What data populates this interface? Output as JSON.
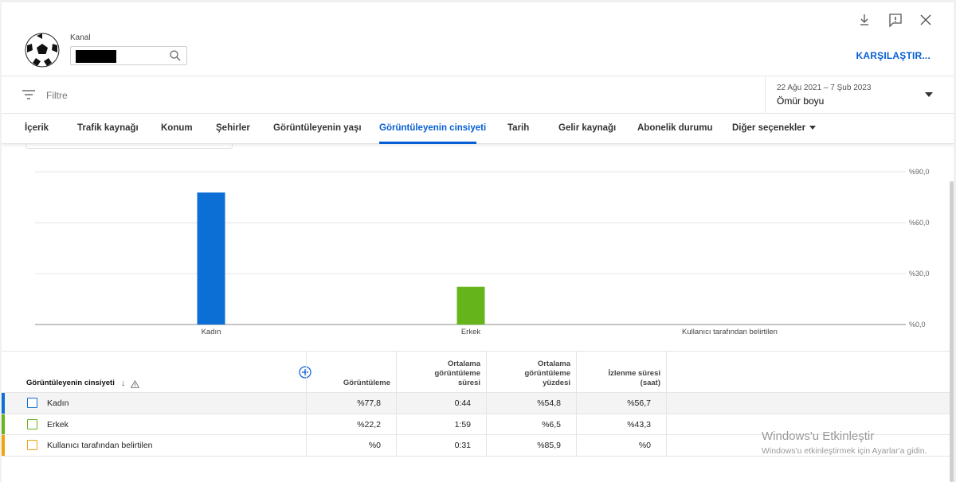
{
  "header": {
    "channel_label": "Kanal",
    "compare_label": "KARŞILAŞTIR..."
  },
  "filter": {
    "placeholder": "Filtre",
    "date_range": "22 Ağu 2021 – 7 Şub 2023",
    "date_preset": "Ömür boyu"
  },
  "tabs": [
    {
      "label": "İçerik"
    },
    {
      "label": "Trafik kaynağı"
    },
    {
      "label": "Konum"
    },
    {
      "label": "Şehirler"
    },
    {
      "label": "Görüntüleyenin yaşı"
    },
    {
      "label": "Görüntüleyenin cinsiyeti",
      "active": true
    },
    {
      "label": "Tarih"
    },
    {
      "label": "Gelir kaynağı"
    },
    {
      "label": "Abonelik durumu"
    },
    {
      "label": "Diğer seçenekler"
    }
  ],
  "chart_data": {
    "type": "bar",
    "categories": [
      "Kadın",
      "Erkek",
      "Kullanıcı tarafından belirtilen"
    ],
    "values": [
      77.8,
      22.2,
      0
    ],
    "colors": [
      "#0b6fd6",
      "#66b41b",
      "#f0a30a"
    ],
    "ylim": [
      0,
      90
    ],
    "yticks": [
      0,
      30,
      60,
      90
    ],
    "ytick_labels": [
      "%0,0",
      "%30,0",
      "%60,0",
      "%90,0"
    ],
    "grid": true
  },
  "table": {
    "headers": [
      "Görüntüleyenin cinsiyeti",
      "Görüntüleme",
      "Ortalama görüntüleme süresi",
      "Ortalama görüntüleme yüzdesi",
      "İzlenme süresi (saat)"
    ],
    "rows": [
      {
        "label": "Kadın",
        "color": "#0b6fd6",
        "views": "%77,8",
        "avg_duration": "0:44",
        "avg_percent": "%54,8",
        "watch_time": "%56,7"
      },
      {
        "label": "Erkek",
        "color": "#66b41b",
        "views": "%22,2",
        "avg_duration": "1:59",
        "avg_percent": "%6,5",
        "watch_time": "%43,3"
      },
      {
        "label": "Kullanıcı tarafından belirtilen",
        "color": "#f0a30a",
        "views": "%0",
        "avg_duration": "0:31",
        "avg_percent": "%85,9",
        "watch_time": "%0"
      }
    ]
  },
  "watermark": {
    "title": "Windows'u Etkinleştir",
    "subtitle": "Windows'u etkinleştirmek için Ayarlar'a gidin."
  }
}
